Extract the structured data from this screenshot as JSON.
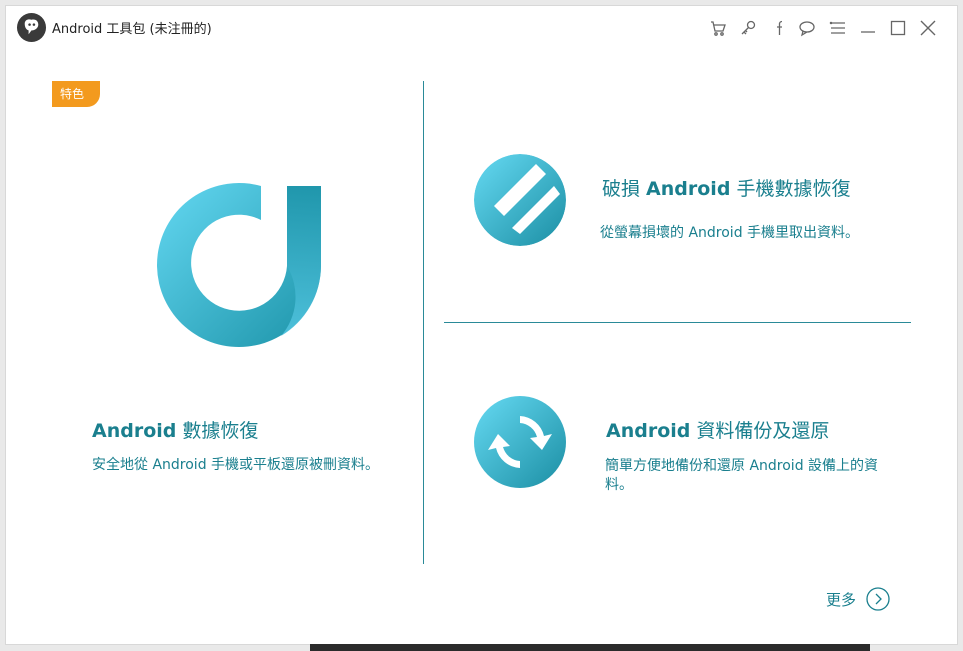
{
  "window": {
    "title": "Android 工具包 (未注冊的)"
  },
  "toolbar": {
    "icons": [
      "cart-icon",
      "key-icon",
      "facebook-icon",
      "chat-icon",
      "menu-icon",
      "minimize-icon",
      "maximize-icon",
      "close-icon"
    ]
  },
  "badge": {
    "label": "特色",
    "color": "#f39a1e"
  },
  "features": {
    "recovery": {
      "title_brand": "Android",
      "title_rest": " 數據恢復",
      "description": "安全地從 Android 手機或平板還原被刪資料。"
    },
    "broken": {
      "title_prefix": "破損 ",
      "title_brand": "Android",
      "title_rest": " 手機數據恢復",
      "description": "從螢幕損壞的 Android 手機里取出資料。"
    },
    "backup": {
      "title_brand": "Android",
      "title_rest": " 資料備份及還原",
      "description": "簡單方便地備份和還原 Android 設備上的資料。"
    }
  },
  "more": {
    "label": "更多"
  },
  "colors": {
    "accent": "#1a7f8e",
    "logo_light": "#5fd3ee",
    "logo_dark": "#1a8fa3"
  }
}
